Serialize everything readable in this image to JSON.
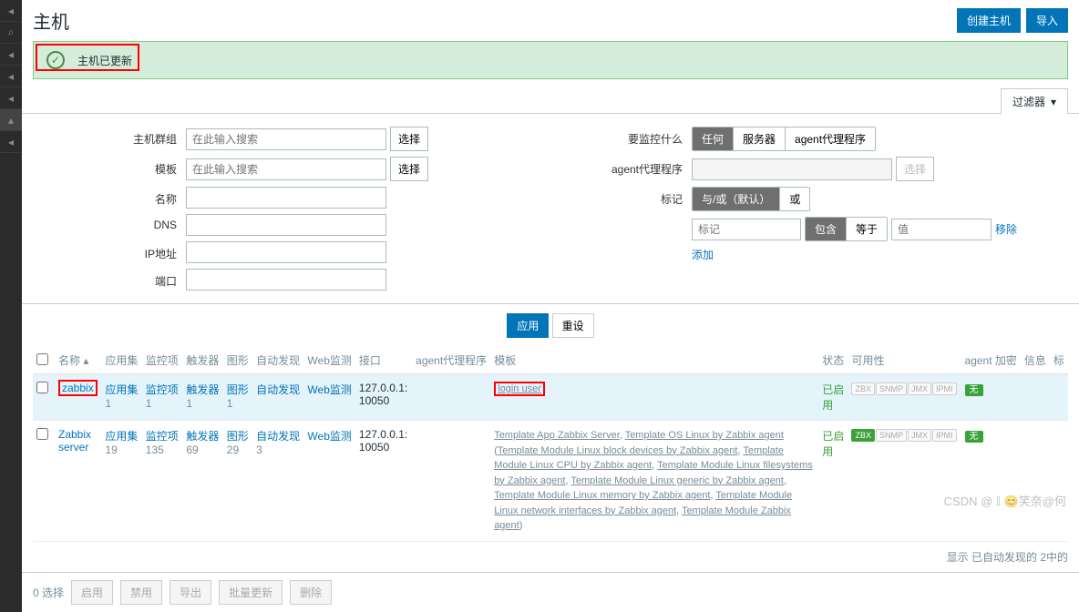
{
  "header": {
    "title": "主机",
    "create": "创建主机",
    "import": "导入"
  },
  "banner": {
    "msg": "主机已更新"
  },
  "filter": {
    "tab": "过滤器",
    "labels": {
      "hostgroup": "主机群组",
      "template": "模板",
      "name": "名称",
      "dns": "DNS",
      "ip": "IP地址",
      "port": "端口",
      "monitor": "要监控什么",
      "proxy": "agent代理程序",
      "tags": "标记"
    },
    "placeholder_search": "在此输入搜索",
    "placeholder_tag": "标记",
    "placeholder_value": "值",
    "btn_select": "选择",
    "monitor_opts": [
      "任何",
      "服务器",
      "agent代理程序"
    ],
    "tag_mode": [
      "与/或（默认）",
      "或"
    ],
    "contains": "包含",
    "equals": "等于",
    "remove": "移除",
    "add": "添加",
    "apply": "应用",
    "reset": "重设"
  },
  "columns": {
    "name": "名称",
    "apps": "应用集",
    "items": "监控项",
    "triggers": "触发器",
    "graphs": "图形",
    "discovery": "自动发现",
    "web": "Web监测",
    "interface": "接口",
    "proxy": "agent代理程序",
    "templates": "模板",
    "status": "状态",
    "availability": "可用性",
    "encryption": "agent 加密",
    "info": "信息",
    "tag": "标"
  },
  "rows": [
    {
      "name": "zabbix",
      "apps": "应用集",
      "apps_n": "1",
      "items": "监控项",
      "items_n": "1",
      "triggers": "触发器",
      "triggers_n": "1",
      "graphs": "图形",
      "graphs_n": "1",
      "discovery": "自动发现",
      "web": "Web监测",
      "interface": "127.0.0.1: 10050",
      "templates_plain": "login user",
      "status": "已启用",
      "zbx_green": false,
      "enc": "无"
    },
    {
      "name": "Zabbix server",
      "apps": "应用集",
      "apps_n": "19",
      "items": "监控项",
      "items_n": "135",
      "triggers": "触发器",
      "triggers_n": "69",
      "graphs": "图形",
      "graphs_n": "29",
      "discovery": "自动发现",
      "discovery_n": "3",
      "web": "Web监测",
      "interface": "127.0.0.1: 10050",
      "tmpl_parts": {
        "a": "Template App Zabbix Server",
        "b": "Template OS Linux by Zabbix agent",
        "c": "Template Module Linux block devices by Zabbix agent",
        "d": "Template Module Linux CPU by Zabbix agent",
        "e": "Template Module Linux filesystems by Zabbix agent",
        "f": "Template Module Linux generic by Zabbix agent",
        "g": "Template Module Linux memory by Zabbix agent",
        "h": "Template Module Linux network interfaces by Zabbix agent",
        "i": "Template Module Zabbix agent"
      },
      "status": "已启用",
      "zbx_green": true,
      "enc": "无"
    }
  ],
  "footer": {
    "summary": "显示 已自动发现的 2中的"
  },
  "actions": {
    "selected": "0 选择",
    "enable": "启用",
    "disable": "禁用",
    "export": "导出",
    "massupdate": "批量更新",
    "delete": "删除"
  },
  "watermark": "CSDN @ 𝕀 😊笑奈@何"
}
